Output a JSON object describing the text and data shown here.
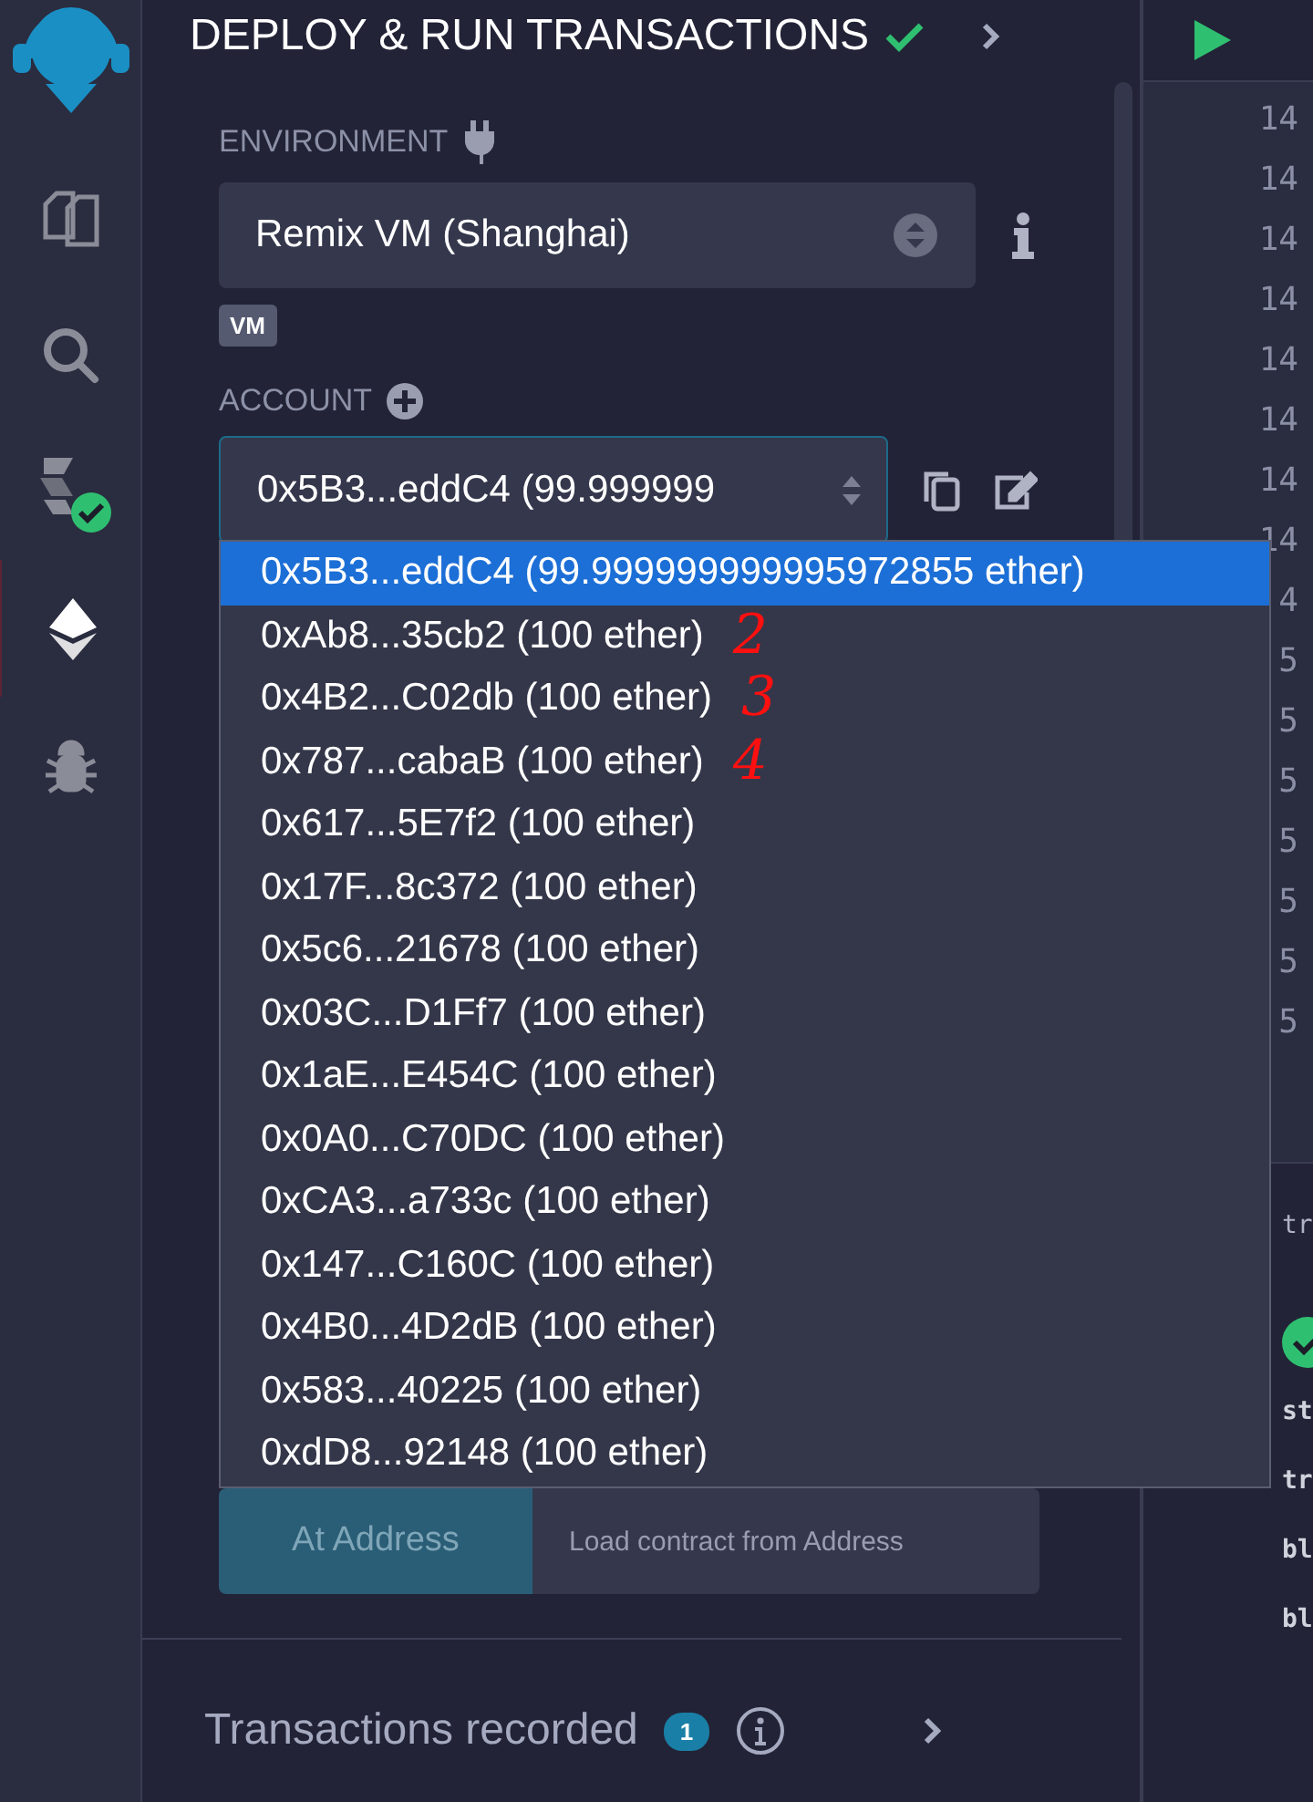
{
  "icon_bar": {
    "items": [
      {
        "kind": "files",
        "selected": false
      },
      {
        "kind": "search",
        "selected": false
      },
      {
        "kind": "compiler",
        "selected": false
      },
      {
        "kind": "deploy",
        "selected": true
      },
      {
        "kind": "debugger",
        "selected": false
      }
    ]
  },
  "panel": {
    "title": "DEPLOY & RUN TRANSACTIONS",
    "environment_label": "ENVIRONMENT",
    "environment": "Remix VM (Shanghai)",
    "environment_badge": "VM",
    "account_label": "ACCOUNT",
    "account": "0x5B3...eddC4 (99.999999",
    "account_options": [
      {
        "label": "0x5B3...eddC4 (99.999999999995972855 ether)",
        "selected": true
      },
      {
        "label": "0xAb8...35cb2 (100 ether)",
        "selected": false,
        "annotation": "2"
      },
      {
        "label": "0x4B2...C02db (100 ether)",
        "selected": false,
        "annotation": "3"
      },
      {
        "label": "0x787...cabaB (100 ether)",
        "selected": false,
        "annotation": "4"
      },
      {
        "label": "0x617...5E7f2 (100 ether)",
        "selected": false
      },
      {
        "label": "0x17F...8c372 (100 ether)",
        "selected": false
      },
      {
        "label": "0x5c6...21678 (100 ether)",
        "selected": false
      },
      {
        "label": "0x03C...D1Ff7 (100 ether)",
        "selected": false
      },
      {
        "label": "0x1aE...E454C (100 ether)",
        "selected": false
      },
      {
        "label": "0x0A0...C70DC (100 ether)",
        "selected": false
      },
      {
        "label": "0xCA3...a733c (100 ether)",
        "selected": false
      },
      {
        "label": "0x147...C160C (100 ether)",
        "selected": false
      },
      {
        "label": "0x4B0...4D2dB (100 ether)",
        "selected": false
      },
      {
        "label": "0x583...40225 (100 ether)",
        "selected": false
      },
      {
        "label": "0xdD8...92148 (100 ether)",
        "selected": false
      }
    ],
    "at_address_button": "At Address",
    "address_placeholder": "Load contract from Address",
    "transactions_label": "Transactions recorded",
    "transactions_count": "1"
  },
  "editor": {
    "line_numbers": [
      "14",
      "14",
      "14",
      "14",
      "14",
      "14",
      "14",
      "14",
      "4",
      "5",
      "5",
      "5",
      "5",
      "5",
      "5",
      "5"
    ]
  },
  "terminal": {
    "lines": [
      "tr",
      "st",
      "tr",
      "bl",
      "bl"
    ]
  }
}
